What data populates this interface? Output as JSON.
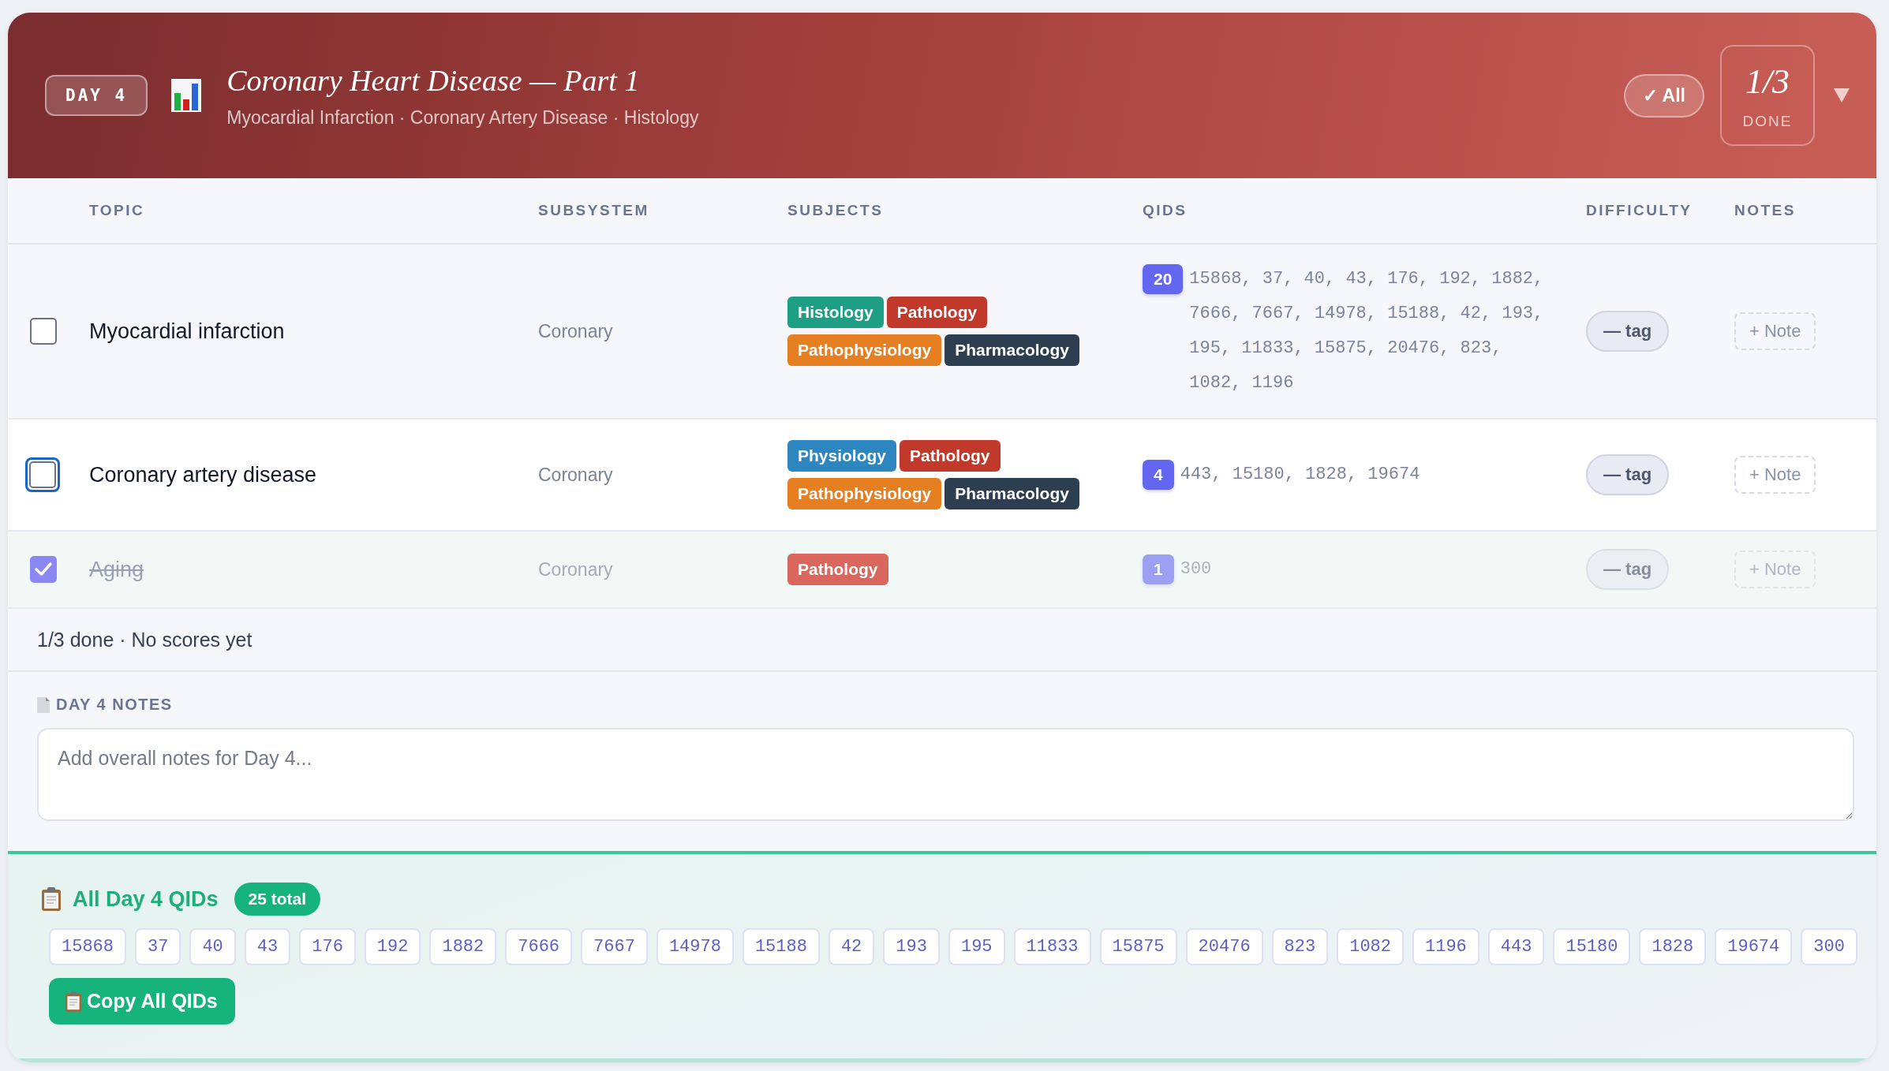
{
  "header": {
    "day_badge": "DAY 4",
    "title": "Coronary Heart Disease — Part 1",
    "subtitle": "Myocardial Infarction · Coronary Artery Disease · Histology",
    "all_button": "✓ All",
    "progress": "1/3",
    "progress_label": "DONE"
  },
  "table": {
    "columns": [
      "TOPIC",
      "SUBSYSTEM",
      "SUBJECTS",
      "QIDS",
      "DIFFICULTY",
      "NOTES"
    ],
    "rows": [
      {
        "checked": false,
        "focused": false,
        "topic": "Myocardial infarction",
        "subsystem": "Coronary",
        "subjects": [
          {
            "label": "Histology",
            "color": "#1e9e84"
          },
          {
            "label": "Pathology",
            "color": "#c0392b"
          },
          {
            "label": "Pathophysiology",
            "color": "#e67e22"
          },
          {
            "label": "Pharmacology",
            "color": "#2c3e50"
          }
        ],
        "qid_count": "20",
        "qids": "15868, 37, 40, 43, 176, 192, 1882, 7666, 7667, 14978, 15188, 42, 193, 195, 11833, 15875, 20476, 823, 1082, 1196",
        "difficulty": "— tag",
        "note": "+ Note"
      },
      {
        "checked": false,
        "focused": true,
        "topic": "Coronary artery disease",
        "subsystem": "Coronary",
        "subjects": [
          {
            "label": "Physiology",
            "color": "#2e86c1"
          },
          {
            "label": "Pathology",
            "color": "#c0392b"
          },
          {
            "label": "Pathophysiology",
            "color": "#e67e22"
          },
          {
            "label": "Pharmacology",
            "color": "#2c3e50"
          }
        ],
        "qid_count": "4",
        "qids": "443, 15180, 1828, 19674",
        "difficulty": "— tag",
        "note": "+ Note"
      },
      {
        "checked": true,
        "focused": false,
        "topic": "Aging",
        "subsystem": "Coronary",
        "subjects": [
          {
            "label": "Pathology",
            "color": "#d9675d"
          }
        ],
        "qid_count": "1",
        "qids": "300",
        "difficulty": "— tag",
        "note": "+ Note"
      }
    ]
  },
  "summary": "1/3 done · No scores yet",
  "notes": {
    "title": "DAY 4 NOTES",
    "placeholder": "Add overall notes for Day 4..."
  },
  "qid_panel": {
    "title": "All Day 4 QIDs",
    "total": "25 total",
    "qids": [
      "15868",
      "37",
      "40",
      "43",
      "176",
      "192",
      "1882",
      "7666",
      "7667",
      "14978",
      "15188",
      "42",
      "193",
      "195",
      "11833",
      "15875",
      "20476",
      "823",
      "1082",
      "1196",
      "443",
      "15180",
      "1828",
      "19674",
      "300"
    ],
    "copy_button": "Copy All QIDs"
  }
}
